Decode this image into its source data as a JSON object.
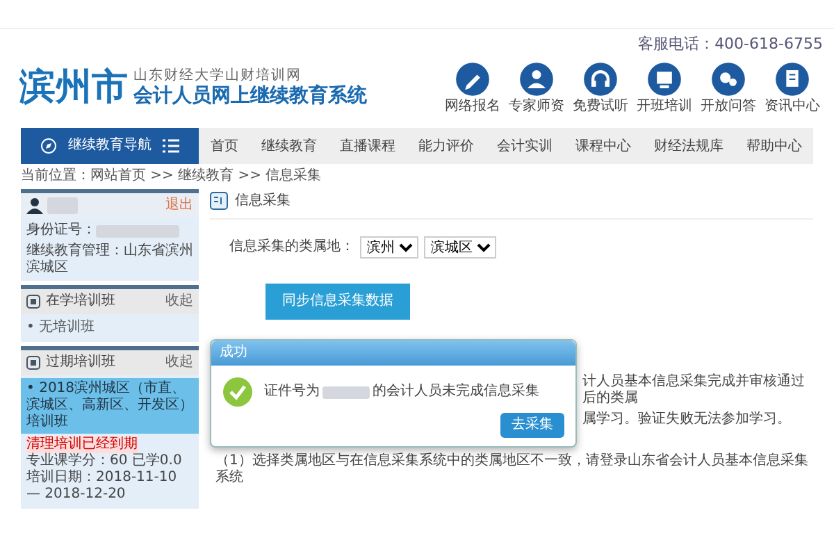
{
  "top_bar": {
    "phone": "客服电话：400-618-6755"
  },
  "logo": {
    "city": "滨州市",
    "subtitle": "山东财经大学山财培训网",
    "title": "会计人员网上继续教育系统"
  },
  "quick_links": [
    {
      "label": "网络报名",
      "kind": "pen"
    },
    {
      "label": "专家师资",
      "kind": "person"
    },
    {
      "label": "免费试听",
      "kind": "headset"
    },
    {
      "label": "开班培训",
      "kind": "screen"
    },
    {
      "label": "开放问答",
      "kind": "chat"
    },
    {
      "label": "资讯中心",
      "kind": "doc"
    }
  ],
  "nav": {
    "title": "继续教育导航",
    "items": [
      {
        "label": "首页",
        "selected": false
      },
      {
        "label": "继续教育",
        "selected": false
      },
      {
        "label": "直播课程",
        "selected": false
      },
      {
        "label": "能力评价",
        "selected": false
      },
      {
        "label": "会计实训",
        "selected": false
      },
      {
        "label": "课程中心",
        "selected": false
      },
      {
        "label": "财经法规库",
        "selected": false
      },
      {
        "label": "帮助中心",
        "selected": false
      }
    ]
  },
  "breadcrumb": "当前位置：网站首页 >> 继续教育 >> 信息采集",
  "sidebar": {
    "user": {
      "logout": "退出",
      "id_label": "身份证号：",
      "unit": "继续教育管理：山东省滨州滨城区"
    },
    "sections": [
      {
        "title": "收起",
        "heading": "在学培训班",
        "items": [
          {
            "text": "• 无培训班",
            "selected": false
          }
        ]
      },
      {
        "title": "收起",
        "heading": "过期培训班",
        "items": [
          {
            "text": "• 2018滨州城区（市直、滨城区、高新区、开发区）培训班",
            "selected": true
          }
        ],
        "details": {
          "status": "清理培训已经到期",
          "credits": "专业课学分：60 已学0.0",
          "dates": "培训日期：2018-11-10 — 2018-12-20"
        }
      }
    ]
  },
  "panel": {
    "title": "信息采集",
    "field_label": "信息采集的类属地：",
    "selects": [
      "滨州",
      "滨城区"
    ],
    "button": "同步信息采集数据",
    "notes": [
      "计人员基本信息采集完成并审核通过后的类属",
      "属学习。验证失败无法参加学习。",
      "（1）选择类属地区与在信息采集系统中的类属地区不一致，请登录山东省会计人员基本信息采集系统"
    ]
  },
  "dialog": {
    "title": "成功",
    "message_before": "证件号为",
    "message_after": "的会计人员未完成信息采集",
    "button": "去采集"
  }
}
